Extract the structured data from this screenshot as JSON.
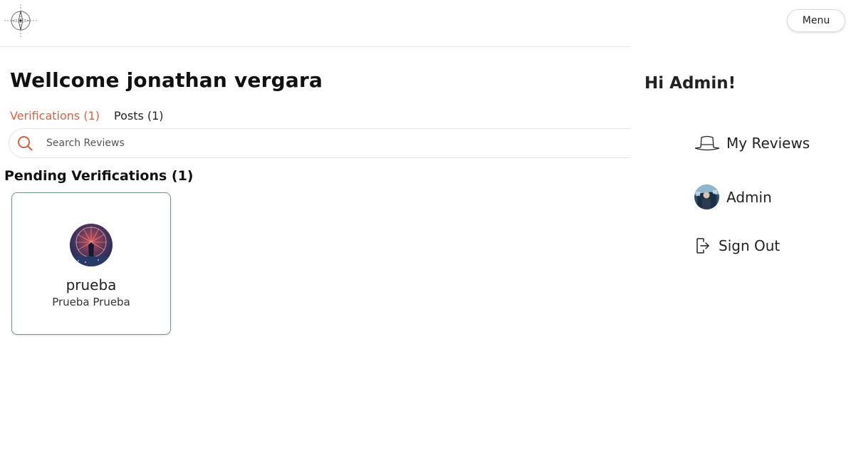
{
  "header": {
    "logo_icon": "compass-logo-icon"
  },
  "main": {
    "welcome": "Wellcome jonathan vergara",
    "tabs": [
      {
        "label": "Verifications (1)",
        "active": true
      },
      {
        "label": "Posts (1)",
        "active": false
      }
    ],
    "search": {
      "placeholder": "Search Reviews",
      "value": "",
      "icon": "search-icon"
    },
    "section_title": "Pending Verifications (1)",
    "cards": [
      {
        "name": "prueba",
        "subtitle": "Prueba Prueba",
        "avatar_icon": "ferris-wheel-avatar"
      }
    ]
  },
  "side": {
    "menu_label": "Menu",
    "greeting": "Hi Admin!",
    "items": [
      {
        "label": "My Reviews",
        "icon": "hat-icon"
      },
      {
        "label": "Admin",
        "icon": "admin-avatar"
      },
      {
        "label": "Sign Out",
        "icon": "sign-out-icon"
      }
    ]
  },
  "colors": {
    "accent": "#e0603b",
    "card_border": "#6b9a8c",
    "text": "#222222"
  }
}
